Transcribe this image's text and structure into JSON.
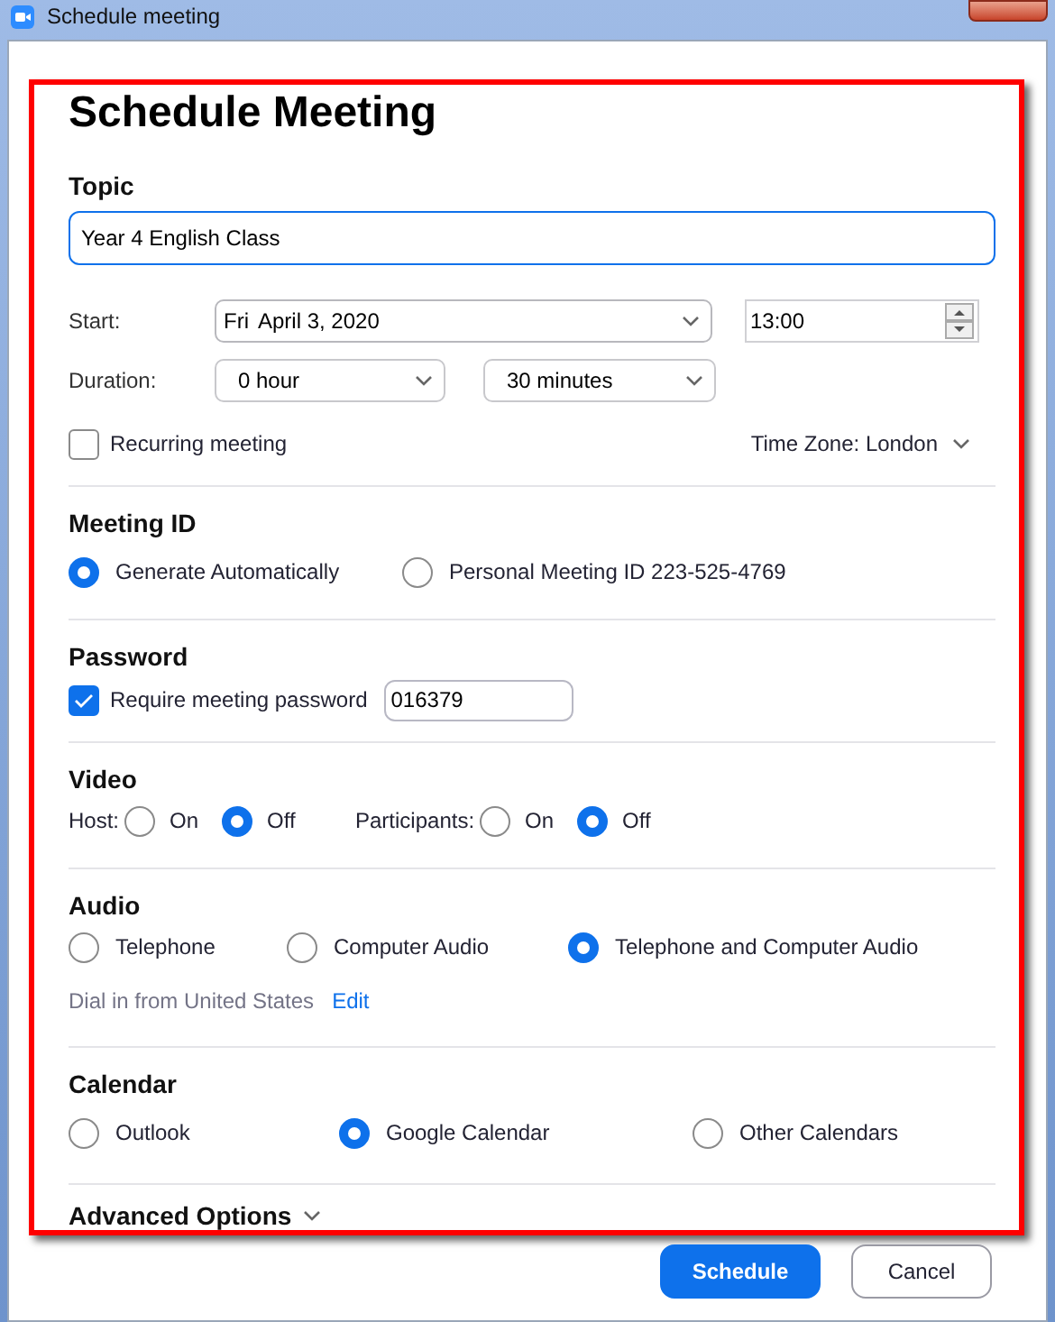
{
  "window": {
    "title": "Schedule meeting"
  },
  "heading": "Schedule Meeting",
  "topic": {
    "label": "Topic",
    "value": "Year 4 English Class"
  },
  "start": {
    "label": "Start:",
    "day": "Fri",
    "date": "April 3, 2020",
    "time": "13:00"
  },
  "duration": {
    "label": "Duration:",
    "hours": "0 hour",
    "minutes": "30 minutes"
  },
  "recurring": {
    "label": "Recurring meeting",
    "checked": false
  },
  "time_zone": "Time Zone: London",
  "meeting_id": {
    "title": "Meeting ID",
    "options": [
      {
        "label": "Generate Automatically",
        "selected": true
      },
      {
        "label": "Personal Meeting ID 223-525-4769",
        "selected": false
      }
    ]
  },
  "password": {
    "title": "Password",
    "require": {
      "label": "Require meeting password",
      "checked": true
    },
    "value": "016379"
  },
  "video": {
    "title": "Video",
    "groups": [
      {
        "label": "Host:",
        "options": [
          {
            "label": "On",
            "selected": false
          },
          {
            "label": "Off",
            "selected": true
          }
        ]
      },
      {
        "label": "Participants:",
        "options": [
          {
            "label": "On",
            "selected": false
          },
          {
            "label": "Off",
            "selected": true
          }
        ]
      }
    ]
  },
  "audio": {
    "title": "Audio",
    "options": [
      {
        "label": "Telephone",
        "selected": false
      },
      {
        "label": "Computer Audio",
        "selected": false
      },
      {
        "label": "Telephone and Computer Audio",
        "selected": true
      }
    ],
    "dial_in": "Dial in from United States",
    "edit_link": "Edit"
  },
  "calendar": {
    "title": "Calendar",
    "options": [
      {
        "label": "Outlook",
        "selected": false
      },
      {
        "label": "Google Calendar",
        "selected": true
      },
      {
        "label": "Other Calendars",
        "selected": false
      }
    ]
  },
  "advanced_options": "Advanced Options",
  "buttons": [
    {
      "label": "Schedule",
      "primary": true
    },
    {
      "label": "Cancel",
      "primary": false
    }
  ]
}
